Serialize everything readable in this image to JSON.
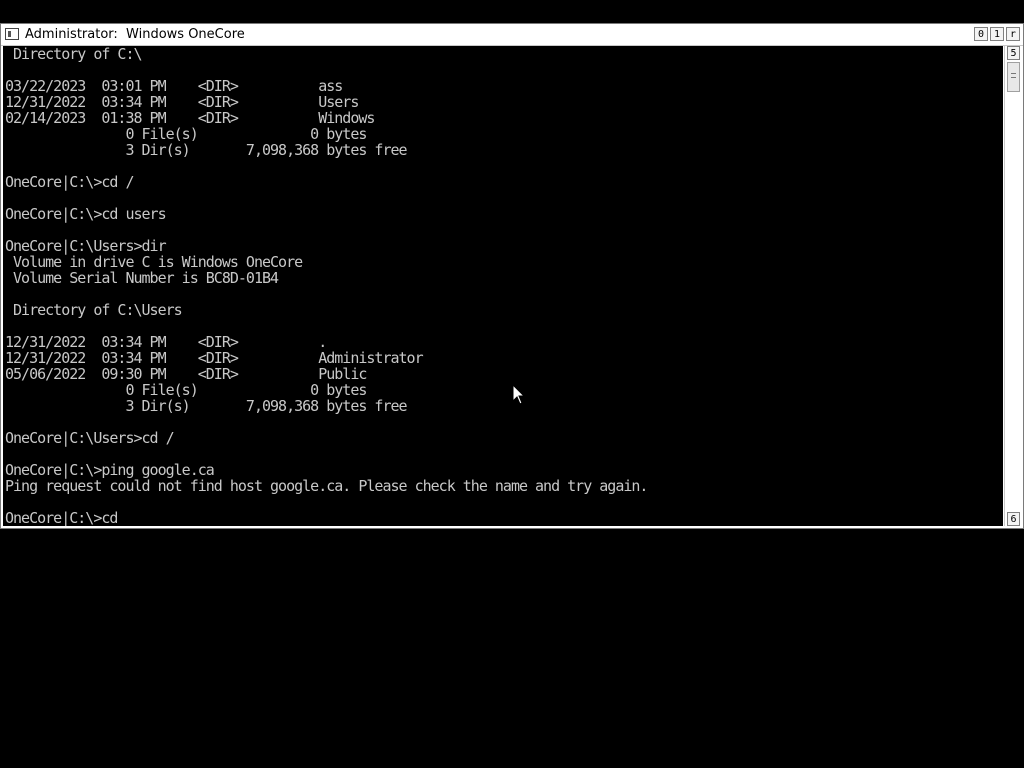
{
  "window": {
    "title": "Administrator:  Windows OneCore",
    "buttons": {
      "minimize": "0",
      "maximize": "1",
      "close": "r"
    }
  },
  "scrollbar": {
    "up": "5",
    "down": "6"
  },
  "console": {
    "lines": [
      " Directory of C:\\",
      "",
      "03/22/2023  03:01 PM    <DIR>          ass",
      "12/31/2022  03:34 PM    <DIR>          Users",
      "02/14/2023  01:38 PM    <DIR>          Windows",
      "               0 File(s)              0 bytes",
      "               3 Dir(s)       7,098,368 bytes free",
      "",
      "OneCore|C:\\>cd /",
      "",
      "OneCore|C:\\>cd users",
      "",
      "OneCore|C:\\Users>dir",
      " Volume in drive C is Windows OneCore",
      " Volume Serial Number is BC8D-01B4",
      "",
      " Directory of C:\\Users",
      "",
      "12/31/2022  03:34 PM    <DIR>          .",
      "12/31/2022  03:34 PM    <DIR>          Administrator",
      "05/06/2022  09:30 PM    <DIR>          Public",
      "               0 File(s)              0 bytes",
      "               3 Dir(s)       7,098,368 bytes free",
      "",
      "OneCore|C:\\Users>cd /",
      "",
      "OneCore|C:\\>ping google.ca",
      "Ping request could not find host google.ca. Please check the name and try again.",
      "",
      "OneCore|C:\\>cd"
    ]
  }
}
